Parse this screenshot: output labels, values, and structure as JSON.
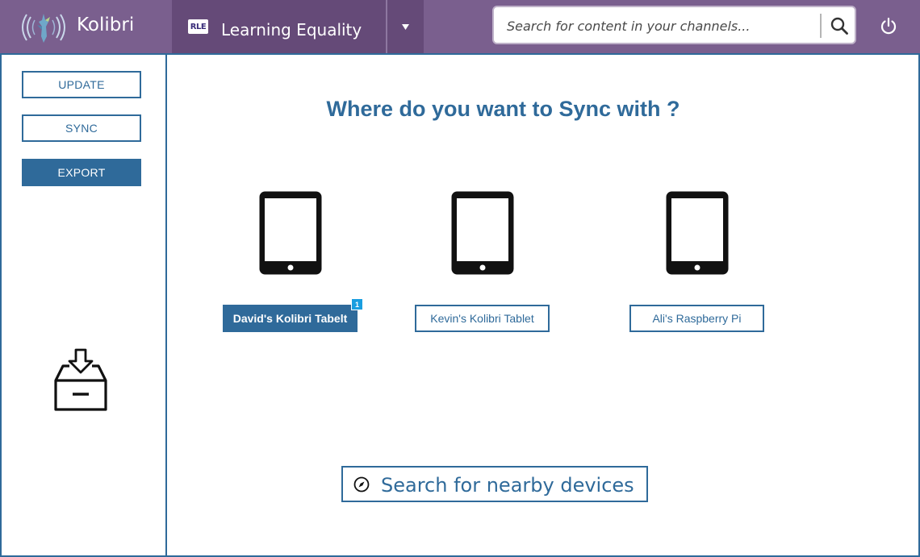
{
  "app": {
    "name": "Kolibri"
  },
  "channel": {
    "logo_text": "RLE",
    "name": "Learning Equality"
  },
  "search": {
    "placeholder": "Search for content in your channels..."
  },
  "sidebar": {
    "buttons": [
      {
        "label": "UPDATE",
        "active": false
      },
      {
        "label": "SYNC",
        "active": false
      },
      {
        "label": "EXPORT",
        "active": true
      }
    ]
  },
  "main": {
    "title": "Where do you want to Sync with ?",
    "devices": [
      {
        "label": "David's Kolibri Tabelt",
        "selected": true,
        "badge": "1"
      },
      {
        "label": "Kevin's Kolibri Tablet",
        "selected": false
      },
      {
        "label": "Ali's Raspberry Pi",
        "selected": false
      }
    ],
    "nearby_label": "Search for nearby devices"
  },
  "icons": {
    "logo": "hummingbird-logo-icon",
    "dropdown": "caret-down-icon",
    "search": "search-icon",
    "power": "power-icon",
    "export": "inbox-download-icon",
    "device": "tablet-icon",
    "compass": "compass-icon"
  },
  "colors": {
    "topbar": "#7a5f8e",
    "channel_bg": "#654a78",
    "accent": "#2f6a9a",
    "badge": "#1a9ee0"
  }
}
